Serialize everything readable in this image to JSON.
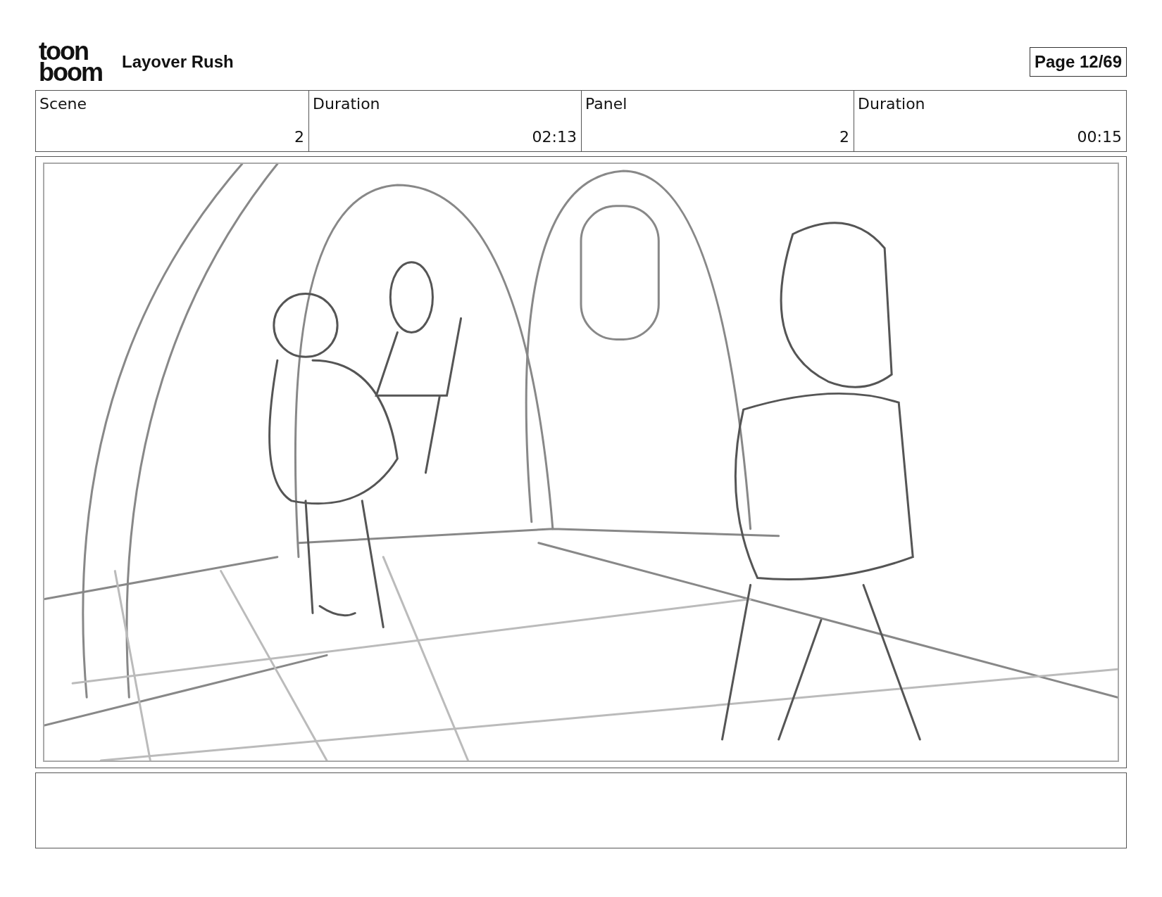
{
  "logo": {
    "line_1": "toon",
    "line_2": "boom"
  },
  "project_title": "Layover Rush",
  "page_indicator": "Page 12/69",
  "info_table": {
    "columns": [
      "Scene",
      "Duration",
      "Panel",
      "Duration"
    ],
    "rows": [
      [
        "2",
        "02:13",
        "2",
        "00:15"
      ]
    ]
  }
}
